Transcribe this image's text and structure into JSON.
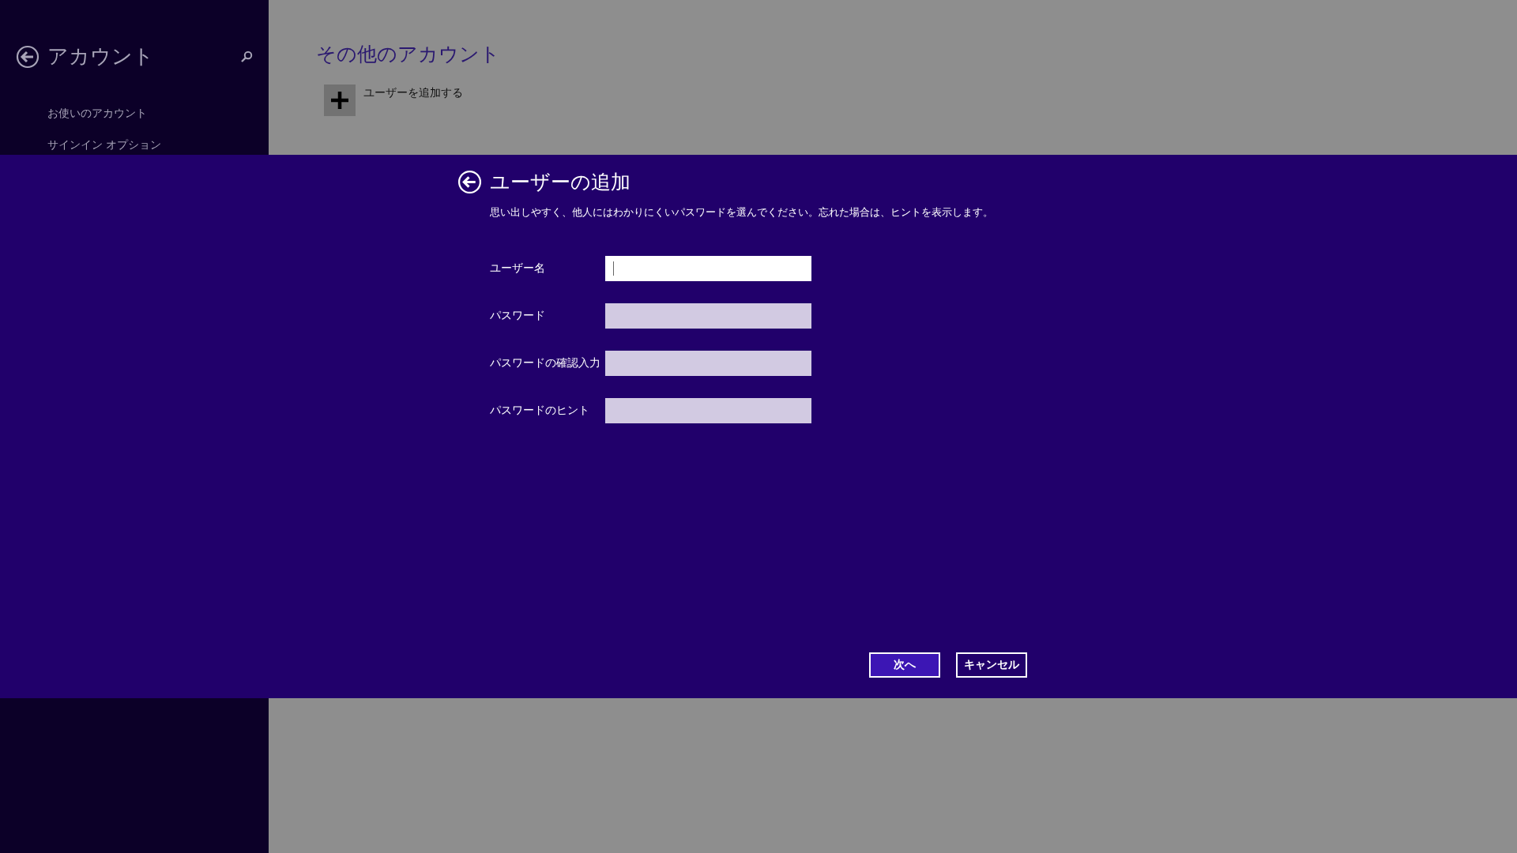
{
  "sidebar": {
    "title": "アカウント",
    "items": [
      {
        "label": "お使いのアカウント",
        "selected": false
      },
      {
        "label": "サインイン オプション",
        "selected": false
      }
    ]
  },
  "main": {
    "title": "その他のアカウント",
    "add_user": "ユーザーを追加する"
  },
  "dialog": {
    "title": "ユーザーの追加",
    "description": "思い出しやすく、他人にはわかりにくいパスワードを選んでください。忘れた場合は、ヒントを表示します。",
    "fields": [
      {
        "label": "ユーザー名",
        "focused": true
      },
      {
        "label": "パスワード",
        "focused": false
      },
      {
        "label": "パスワードの確認入力",
        "focused": false
      },
      {
        "label": "パスワードのヒント",
        "focused": false
      }
    ],
    "buttons": [
      {
        "label": "次へ",
        "kind": "primary"
      },
      {
        "label": "キャンセル",
        "kind": "secondary"
      }
    ]
  }
}
